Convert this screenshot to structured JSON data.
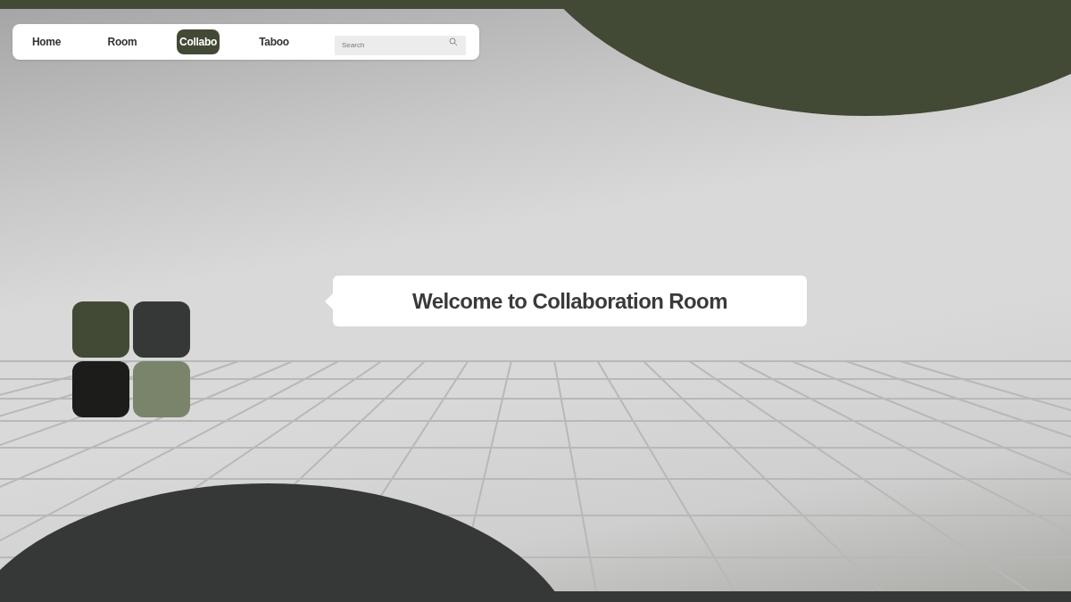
{
  "nav": {
    "tabs": [
      {
        "label": "Home",
        "selected": false
      },
      {
        "label": "Room",
        "selected": false
      },
      {
        "label": "Collabo",
        "selected": true
      },
      {
        "label": "Taboo",
        "selected": false
      }
    ],
    "search": {
      "placeholder": "Search"
    }
  },
  "swatches": [
    {
      "color": "#424935"
    },
    {
      "color": "#363837"
    },
    {
      "color": "#1c1d1b"
    },
    {
      "color": "#7a846a"
    }
  ],
  "welcome": {
    "text": "Welcome to Collaboration Room"
  }
}
